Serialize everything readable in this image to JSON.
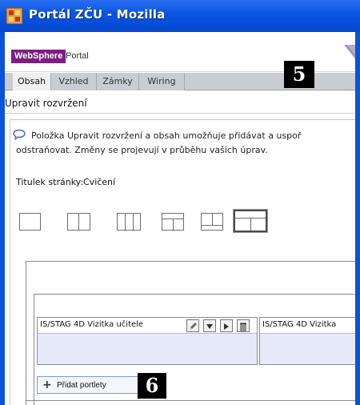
{
  "window": {
    "title": "Portál ZČU - Mozilla",
    "app_icon": "grid-app-icon"
  },
  "portal": {
    "logo_text": "WebSphere",
    "product_text": "Portal",
    "brand_color": "#7a1f80"
  },
  "tabs": [
    {
      "label": "Obsah",
      "active": true
    },
    {
      "label": "Vzhled",
      "active": false
    },
    {
      "label": "Zámky",
      "active": false
    },
    {
      "label": "Wiring",
      "active": false
    }
  ],
  "callouts": [
    "5",
    "6"
  ],
  "page": {
    "heading": "Upravit rozvržení",
    "info_line1": "Položka Upravit rozvržení a obsah umožňuje přidávat a uspoř",
    "info_line2": "odstraňovat. Změny se projevují v průběhu vašich úprav.",
    "page_title_label": "Titulek stránky:",
    "page_title_value": "Cvičení"
  },
  "layout_options": [
    {
      "name": "one-column"
    },
    {
      "name": "two-columns"
    },
    {
      "name": "three-columns"
    },
    {
      "name": "row-over-two-columns"
    },
    {
      "name": "two-columns-over-row"
    },
    {
      "name": "row-over-two-columns-selected",
      "selected": true
    }
  ],
  "portlets": [
    {
      "title": "IS/STAG 4D Vizitka učitele"
    },
    {
      "title": "IS/STAG 4D Vizitka"
    }
  ],
  "portlet_controls": [
    "edit-icon",
    "move-down-icon",
    "move-right-icon",
    "delete-icon"
  ],
  "add_portlets_label": "Přidat portlety"
}
